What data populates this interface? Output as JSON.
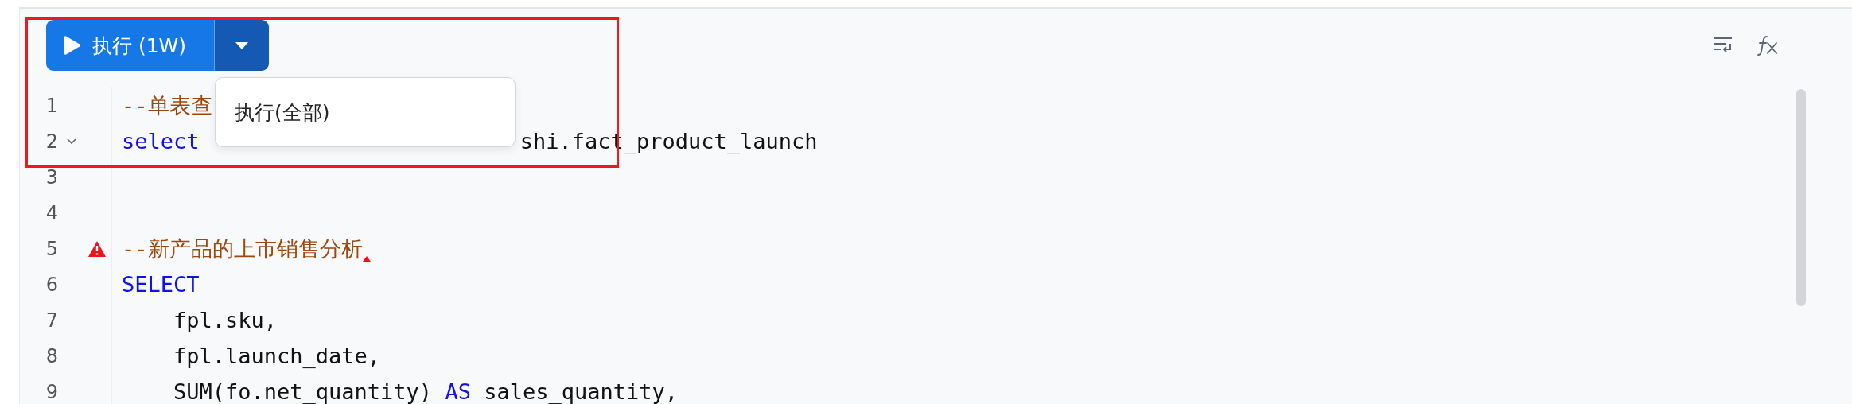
{
  "toolbar": {
    "highlighted": true,
    "run_button": {
      "label": "执行 (1W)"
    },
    "run_menu": {
      "expanded": true,
      "items": [
        {
          "label": "执行(全部)"
        }
      ]
    }
  },
  "editor": {
    "lines": [
      {
        "number": "1",
        "foldable": false,
        "warning": false,
        "tokens": [
          {
            "kind": "comment",
            "text": "--单表查"
          }
        ]
      },
      {
        "number": "2",
        "foldable": true,
        "warning": false,
        "tokens": [
          {
            "kind": "keyword",
            "text": "select"
          },
          {
            "kind": "tail",
            "text": "shi.fact_product_launch"
          }
        ]
      },
      {
        "number": "3",
        "foldable": false,
        "warning": false
      },
      {
        "number": "4",
        "foldable": false,
        "warning": false
      },
      {
        "number": "5",
        "foldable": false,
        "warning": true,
        "tokens": [
          {
            "kind": "comment",
            "text": "--新产品的上市销售分析"
          }
        ]
      },
      {
        "number": "6",
        "foldable": false,
        "warning": false,
        "tokens": [
          {
            "kind": "keyword",
            "text": "SELECT"
          }
        ]
      },
      {
        "number": "7",
        "foldable": false,
        "warning": false,
        "tokens": [
          {
            "kind": "plain",
            "text": "    fpl.sku,"
          }
        ]
      },
      {
        "number": "8",
        "foldable": false,
        "warning": false,
        "tokens": [
          {
            "kind": "plain",
            "text": "    fpl.launch_date,"
          }
        ]
      },
      {
        "number": "9",
        "foldable": false,
        "warning": false,
        "tokens": [
          {
            "kind": "plain",
            "text": "    SUM(fo.net_quantity) "
          },
          {
            "kind": "keyword",
            "text": "AS"
          },
          {
            "kind": "plain",
            "text": " sales_quantity,"
          }
        ]
      }
    ]
  }
}
